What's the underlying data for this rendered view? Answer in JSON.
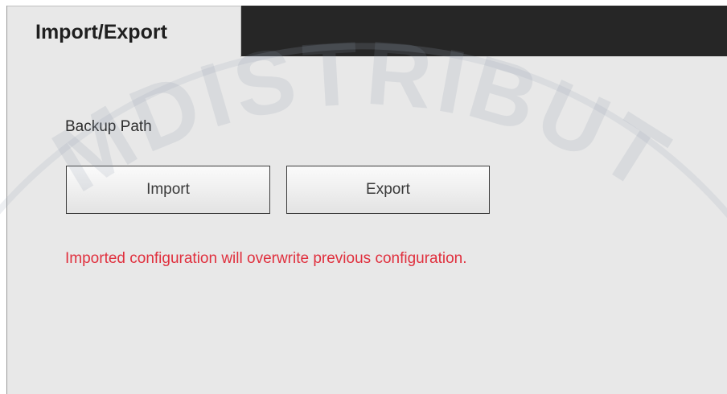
{
  "tab": {
    "label": "Import/Export"
  },
  "backup": {
    "label": "Backup Path"
  },
  "buttons": {
    "import_label": "Import",
    "export_label": "Export"
  },
  "warning": {
    "text": "Imported configuration will overwrite previous configuration."
  },
  "watermark": {
    "text": "MDISTRIBUT"
  },
  "colors": {
    "tab_bar": "#262626",
    "panel": "#e8e8e8",
    "warning": "#e0303e"
  }
}
